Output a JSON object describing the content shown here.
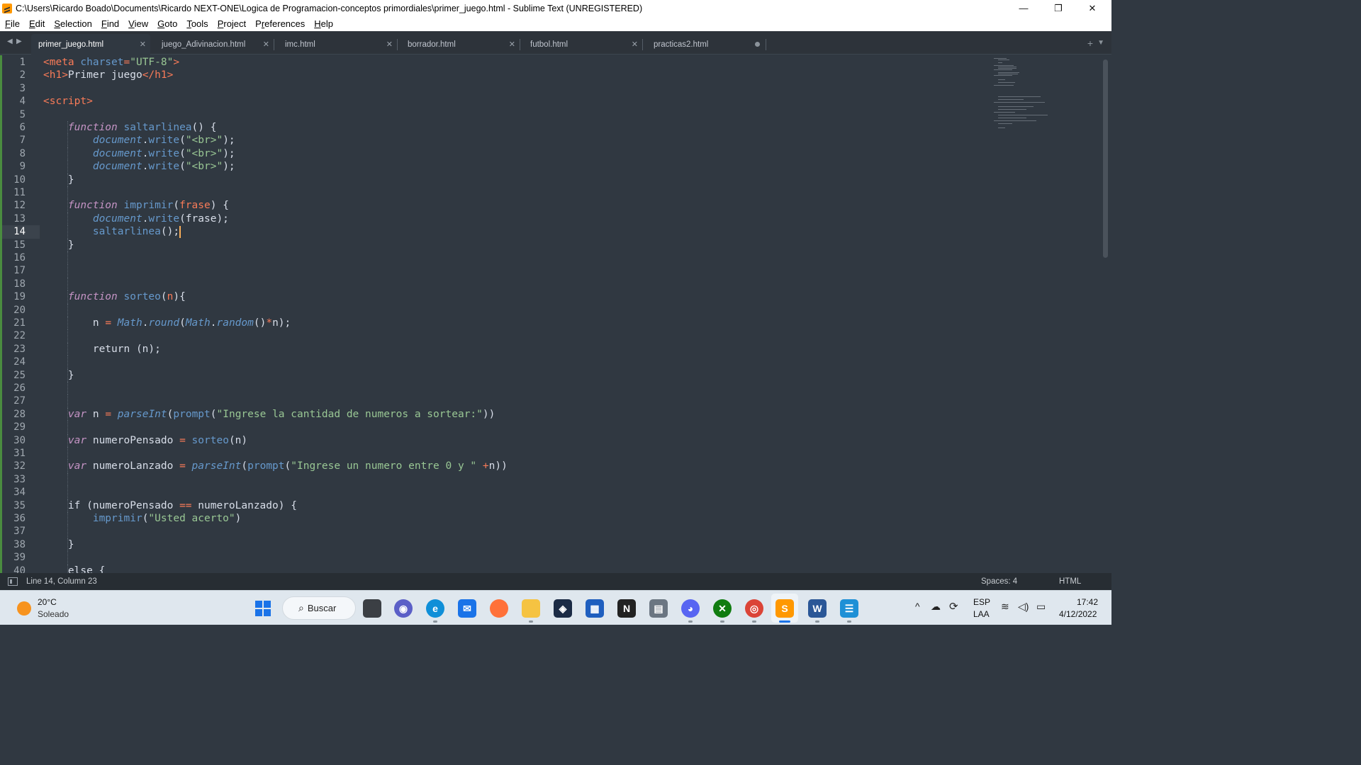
{
  "window": {
    "title": "C:\\Users\\Ricardo Boado\\Documents\\Ricardo NEXT-ONE\\Logica de Programacion-conceptos primordiales\\primer_juego.html - Sublime Text (UNREGISTERED)",
    "controls": {
      "minimize": "—",
      "restore": "❐",
      "close": "✕"
    }
  },
  "menu": {
    "items": [
      {
        "u": "F",
        "rest": "ile"
      },
      {
        "u": "E",
        "rest": "dit"
      },
      {
        "u": "S",
        "rest": "election"
      },
      {
        "u": "F",
        "rest": "ind"
      },
      {
        "u": "V",
        "rest": "iew"
      },
      {
        "u": "G",
        "rest": "oto"
      },
      {
        "u": "T",
        "rest": "ools"
      },
      {
        "u": "P",
        "rest": "roject"
      },
      {
        "u": "",
        "rest": "Preferences",
        "ul_index": 1
      },
      {
        "u": "H",
        "rest": "elp"
      }
    ]
  },
  "tabs": [
    {
      "label": "primer_juego.html",
      "active": true,
      "state": "close"
    },
    {
      "label": "juego_Adivinacion.html",
      "active": false,
      "state": "close"
    },
    {
      "label": "imc.html",
      "active": false,
      "state": "close"
    },
    {
      "label": "borrador.html",
      "active": false,
      "state": "close"
    },
    {
      "label": "futbol.html",
      "active": false,
      "state": "close"
    },
    {
      "label": "practicas2.html",
      "active": false,
      "state": "modified"
    }
  ],
  "editor": {
    "current_line": 14,
    "line_count_visible": 40
  },
  "status": {
    "position": "Line 14, Column 23",
    "indentation": "Spaces: 4",
    "syntax": "HTML"
  },
  "taskbar": {
    "weather": {
      "temp": "20°C",
      "condition": "Soleado"
    },
    "search_label": "Buscar",
    "tray": {
      "lang": "ESP",
      "layout": "LAA",
      "time": "17:42",
      "date": "4/12/2022"
    }
  },
  "colors": {
    "editor_bg": "#303841",
    "keyword": "#c594c5",
    "function": "#6699cc",
    "string": "#99c794",
    "tag": "#f97b58",
    "caret": "#f9ae58"
  }
}
